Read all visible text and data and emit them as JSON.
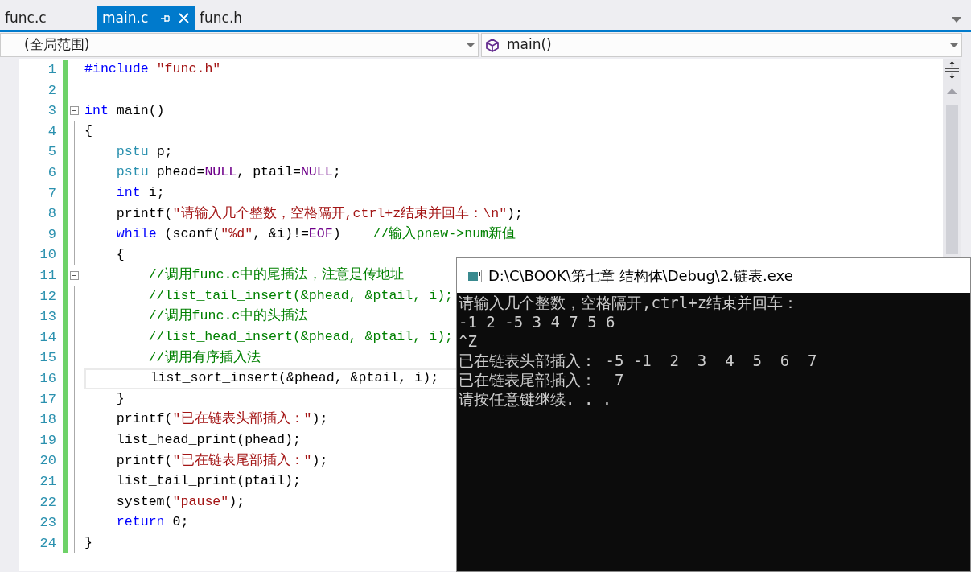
{
  "tabs": [
    {
      "label": "func.c",
      "selected": false
    },
    {
      "label": "main.c",
      "selected": true
    },
    {
      "label": "func.h",
      "selected": false
    }
  ],
  "scope_dropdown": {
    "value": "(全局范围)"
  },
  "member_dropdown": {
    "value": "main()"
  },
  "code_lines": [
    {
      "number": "1",
      "modified": true,
      "fold_start": false,
      "current": false,
      "tokens": [
        {
          "color": "#0000ff",
          "text": "#include"
        },
        {
          "color": "#a31515",
          "text": " \"func.h\""
        }
      ]
    },
    {
      "number": "2",
      "modified": true,
      "fold_start": false,
      "current": false
    },
    {
      "number": "3",
      "modified": true,
      "fold_start": true,
      "current": false,
      "tokens": [
        {
          "color": "#0000ff",
          "text": "int"
        },
        {
          "color": "#000000",
          "text": " main()"
        }
      ]
    },
    {
      "number": "4",
      "modified": true,
      "fold_start": false,
      "current": false,
      "tokens": [
        {
          "color": "#000000",
          "text": "{"
        }
      ]
    },
    {
      "number": "5",
      "modified": true,
      "fold_start": false,
      "current": false,
      "tokens": [
        {
          "color": "#2b91af",
          "text": "    pstu"
        },
        {
          "color": "#000000",
          "text": " p;"
        }
      ]
    },
    {
      "number": "6",
      "modified": true,
      "fold_start": false,
      "current": false,
      "tokens": [
        {
          "color": "#2b91af",
          "text": "    pstu"
        },
        {
          "color": "#000000",
          "text": " phead="
        },
        {
          "color": "#6f008a",
          "text": "NULL"
        },
        {
          "color": "#000000",
          "text": ", ptail="
        },
        {
          "color": "#6f008a",
          "text": "NULL"
        },
        {
          "color": "#000000",
          "text": ";"
        }
      ]
    },
    {
      "number": "7",
      "modified": true,
      "fold_start": false,
      "current": false,
      "tokens": [
        {
          "color": "#0000ff",
          "text": "    int"
        },
        {
          "color": "#000000",
          "text": " i;"
        }
      ]
    },
    {
      "number": "8",
      "modified": true,
      "fold_start": false,
      "current": false,
      "tokens": [
        {
          "color": "#000000",
          "text": "    printf("
        },
        {
          "color": "#a31515",
          "text": "\"请输入几个整数，空格隔开,ctrl+z结束并回车：\\n\""
        },
        {
          "color": "#000000",
          "text": ");"
        }
      ]
    },
    {
      "number": "9",
      "modified": true,
      "fold_start": false,
      "current": false,
      "tokens": [
        {
          "color": "#0000ff",
          "text": "    while"
        },
        {
          "color": "#000000",
          "text": " (scanf("
        },
        {
          "color": "#a31515",
          "text": "\"%d\""
        },
        {
          "color": "#000000",
          "text": ", &i)!="
        },
        {
          "color": "#6f008a",
          "text": "EOF"
        },
        {
          "color": "#000000",
          "text": ")"
        },
        {
          "color": "#008000",
          "text": "    //输入pnew->num新值"
        }
      ]
    },
    {
      "number": "10",
      "modified": true,
      "fold_start": false,
      "current": false,
      "tokens": [
        {
          "color": "#000000",
          "text": "    {"
        }
      ]
    },
    {
      "number": "11",
      "modified": true,
      "fold_start": true,
      "current": false,
      "tokens": [
        {
          "color": "#008000",
          "text": "        //调用func.c中的尾插法，注意是传地址"
        }
      ]
    },
    {
      "number": "12",
      "modified": true,
      "fold_start": false,
      "current": false,
      "tokens": [
        {
          "color": "#008000",
          "text": "        //list_tail_insert(&phead, &ptail, i);"
        }
      ]
    },
    {
      "number": "13",
      "modified": true,
      "fold_start": false,
      "current": false,
      "tokens": [
        {
          "color": "#008000",
          "text": "        //调用func.c中的头插法"
        }
      ]
    },
    {
      "number": "14",
      "modified": true,
      "fold_start": false,
      "current": false,
      "tokens": [
        {
          "color": "#008000",
          "text": "        //list_head_insert(&phead, &ptail, i);"
        }
      ]
    },
    {
      "number": "15",
      "modified": true,
      "fold_start": false,
      "current": false,
      "tokens": [
        {
          "color": "#008000",
          "text": "        //调用有序插入法"
        }
      ]
    },
    {
      "number": "16",
      "modified": true,
      "fold_start": false,
      "current": true,
      "tokens": [
        {
          "color": "#000000",
          "text": "        list_sort_insert(&phead, &ptail, i);"
        }
      ]
    },
    {
      "number": "17",
      "modified": true,
      "fold_start": false,
      "current": false,
      "tokens": [
        {
          "color": "#000000",
          "text": "    }"
        }
      ]
    },
    {
      "number": "18",
      "modified": true,
      "fold_start": false,
      "current": false,
      "tokens": [
        {
          "color": "#000000",
          "text": "    printf("
        },
        {
          "color": "#a31515",
          "text": "\"已在链表头部插入：\""
        },
        {
          "color": "#000000",
          "text": ");"
        }
      ]
    },
    {
      "number": "19",
      "modified": true,
      "fold_start": false,
      "current": false,
      "tokens": [
        {
          "color": "#000000",
          "text": "    list_head_print(phead);"
        }
      ]
    },
    {
      "number": "20",
      "modified": true,
      "fold_start": false,
      "current": false,
      "tokens": [
        {
          "color": "#000000",
          "text": "    printf("
        },
        {
          "color": "#a31515",
          "text": "\"已在链表尾部插入：\""
        },
        {
          "color": "#000000",
          "text": ");"
        }
      ]
    },
    {
      "number": "21",
      "modified": true,
      "fold_start": false,
      "current": false,
      "tokens": [
        {
          "color": "#000000",
          "text": "    list_tail_print(ptail);"
        }
      ]
    },
    {
      "number": "22",
      "modified": true,
      "fold_start": false,
      "current": false,
      "tokens": [
        {
          "color": "#000000",
          "text": "    system("
        },
        {
          "color": "#a31515",
          "text": "\"pause\""
        },
        {
          "color": "#000000",
          "text": ");"
        }
      ]
    },
    {
      "number": "23",
      "modified": true,
      "fold_start": false,
      "current": false,
      "tokens": [
        {
          "color": "#0000ff",
          "text": "    return"
        },
        {
          "color": "#000000",
          "text": " 0;"
        }
      ]
    },
    {
      "number": "24",
      "modified": true,
      "fold_start": false,
      "current": false,
      "tokens": [
        {
          "color": "#000000",
          "text": "}"
        }
      ]
    }
  ],
  "console": {
    "title": "D:\\C\\BOOK\\第七章 结构体\\Debug\\2.链表.exe",
    "lines": [
      "请输入几个整数，空格隔开,ctrl+z结束并回车：",
      "-1 2 -5 3 4 7 5 6",
      "^Z",
      "已在链表头部插入： -5 -1  2  3  4  5  6  7",
      "已在链表尾部插入：  7",
      "请按任意键继续. . ."
    ]
  }
}
